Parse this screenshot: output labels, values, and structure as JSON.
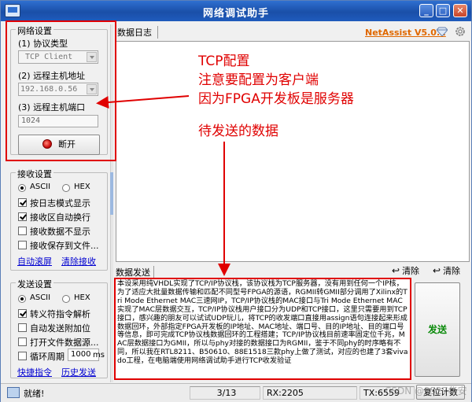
{
  "window": {
    "title": "网络调试助手",
    "minimize": "_",
    "maximize": "□",
    "close": "✕",
    "app_icon": "network-app-icon"
  },
  "net_settings": {
    "legend": "网络设置",
    "protocol_label": "(1) 协议类型",
    "protocol_value": "TCP Client",
    "host_label": "(2) 远程主机地址",
    "host_value": "192.168.0.56",
    "port_label": "(3) 远程主机端口",
    "port_value": "1024",
    "disconnect_label": "断开"
  },
  "recv_settings": {
    "legend": "接收设置",
    "ascii": "ASCII",
    "hex": "HEX",
    "log_mode": "按日志模式显示",
    "auto_wrap": "接收区自动换行",
    "no_display": "接收数据不显示",
    "save_file": "接收保存到文件...",
    "auto_scroll": "自动滚屏",
    "clear_recv": "清除接收"
  },
  "send_settings": {
    "legend": "发送设置",
    "ascii": "ASCII",
    "hex": "HEX",
    "escape": "转义符指令解析",
    "auto_append": "自动发送附加位",
    "open_file": "打开文件数据源...",
    "loop_period": "循环周期",
    "period_value": "1000",
    "period_unit": "ms",
    "shortcut": "快捷指令",
    "history": "历史发送"
  },
  "log": {
    "tab": "数据日志",
    "brand": "NetAssist V5.0.2"
  },
  "send": {
    "tab": "数据发送",
    "clear1": "清除",
    "clear2": "清除",
    "button": "发送",
    "text": "本设采用纯VHDL实现了TCP/IP协议栈，该协议栈为TCP服务器，没有用到任何一个IP核，为了适应大批量数据传输和匹配不同型号FPGA的源语，RGMII转GMII部分调用了Xilinx的Tri Mode Ethernet MAC三速网IP，TCP/IP协议栈的MAC接口与Tri Mode Ethernet MAC实现了MAC层数据交互，TCP/IP协议栈用户接口分为UDP和TCP接口，这里只需要用到TCP接口，感兴趣的朋友可以试试UDP玩儿，将TCP的收发端口直接用assign语句连接起来形成数据回环，外部指定FPGA开发板的IP地址、MAC地址、端口号、目的IP地址、目的端口号等信息，即可完成TCP协议栈数据回环的工程搭建；TCP/IP协议栈目前速率固定位千兆，MAC层数据接口为GMII，所以与phy对接的数据接口为RGMII，鉴于不同phy的时序略有不同，所以我在RTL8211、B50610、88E1518三款phy上做了测试，对应的也建了3套vivado工程，在电脑端使用网络调试助手进行TCP收发验证"
  },
  "status": {
    "ready": "就绪!",
    "count": "3/13",
    "rx": "RX:2205",
    "tx": "TX:6559",
    "reset": "复位计数"
  },
  "annotations": {
    "line1": "TCP配置",
    "line2": "注意要配置为客户端",
    "line3": "因为FPGA开发板是服务器",
    "line4": "待发送的数据",
    "color": "#e00000"
  },
  "watermark": "CSDN @9527华安"
}
